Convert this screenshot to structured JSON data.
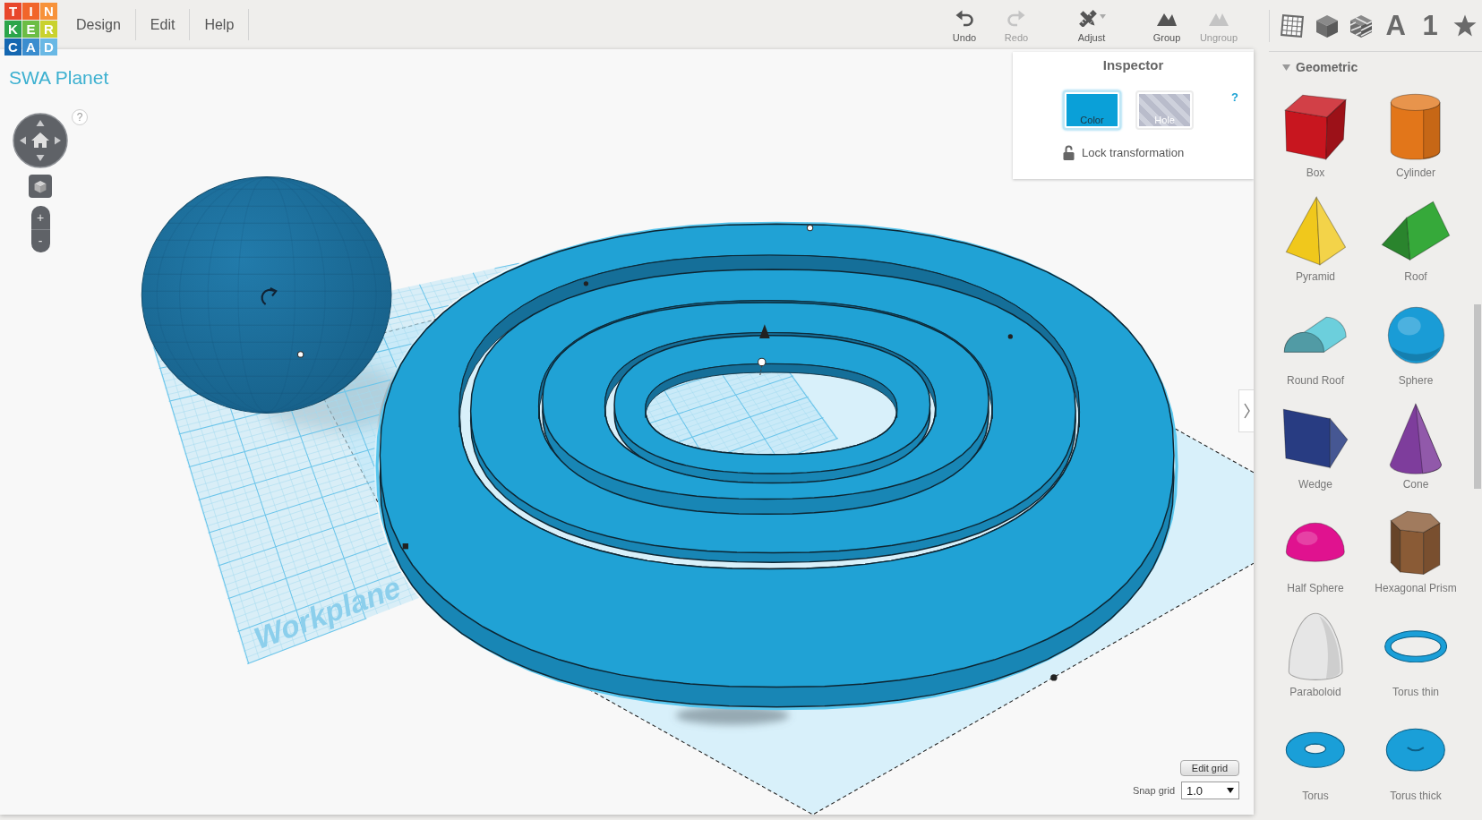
{
  "logo": [
    {
      "letter": "T",
      "color": "#e8472b"
    },
    {
      "letter": "I",
      "color": "#f1652a"
    },
    {
      "letter": "N",
      "color": "#f7923a"
    },
    {
      "letter": "K",
      "color": "#2ba54a"
    },
    {
      "letter": "E",
      "color": "#6cbd45"
    },
    {
      "letter": "R",
      "color": "#c9d22e"
    },
    {
      "letter": "C",
      "color": "#1467b1"
    },
    {
      "letter": "A",
      "color": "#3a8dcf"
    },
    {
      "letter": "D",
      "color": "#69b8e5"
    }
  ],
  "menu": [
    "Design",
    "Edit",
    "Help"
  ],
  "toolbar": [
    {
      "kind": "undo",
      "label": "Undo",
      "disabled": false
    },
    {
      "kind": "redo",
      "label": "Redo",
      "disabled": true
    },
    {
      "kind": "adjust",
      "label": "Adjust",
      "disabled": false
    },
    {
      "kind": "group",
      "label": "Group",
      "disabled": false
    },
    {
      "kind": "ungroup",
      "label": "Ungroup",
      "disabled": true
    }
  ],
  "view_tabs": [
    {
      "kind": "grid"
    },
    {
      "kind": "cube"
    },
    {
      "kind": "striped_cube"
    },
    {
      "kind": "letter",
      "label": "A"
    },
    {
      "kind": "number",
      "label": "1"
    },
    {
      "kind": "star"
    }
  ],
  "design_title": "SWA Planet",
  "view_controls": {
    "help": "?",
    "zoom_in": "+",
    "zoom_out": "-"
  },
  "inspector": {
    "title": "Inspector",
    "help": "?",
    "options": [
      {
        "kind": "color",
        "label": "Color",
        "selected": true,
        "color": "#0aa0d8"
      },
      {
        "kind": "hole",
        "label": "Hole",
        "selected": false
      }
    ],
    "lock": {
      "label": "Lock transformation",
      "locked": false
    }
  },
  "scene": {
    "workplane_label": "Workplane"
  },
  "grid_controls": {
    "edit_button": "Edit grid",
    "snap_label": "Snap grid",
    "snap_value": "1.0"
  },
  "library": {
    "section": "Geometric",
    "expanded": true,
    "shapes": [
      {
        "kind": "box",
        "label": "Box",
        "color": "#c8161f"
      },
      {
        "kind": "cylinder",
        "label": "Cylinder",
        "color": "#e2761a"
      },
      {
        "kind": "pyramid",
        "label": "Pyramid",
        "color": "#f0c81c"
      },
      {
        "kind": "roof",
        "label": "Roof",
        "color": "#36a93a"
      },
      {
        "kind": "round_roof",
        "label": "Round Roof",
        "color": "#6ccfdc"
      },
      {
        "kind": "sphere",
        "label": "Sphere",
        "color": "#1a9cd6"
      },
      {
        "kind": "wedge",
        "label": "Wedge",
        "color": "#283c82"
      },
      {
        "kind": "cone",
        "label": "Cone",
        "color": "#7e3d9c"
      },
      {
        "kind": "half_sphere",
        "label": "Half Sphere",
        "color": "#e0128f"
      },
      {
        "kind": "hexagonal_prism",
        "label": "Hexagonal Prism",
        "color": "#8a5b36"
      },
      {
        "kind": "paraboloid",
        "label": "Paraboloid",
        "color": "#e6e6e6"
      },
      {
        "kind": "torus_thin",
        "label": "Torus thin",
        "color": "#1a9fd8"
      },
      {
        "kind": "torus",
        "label": "Torus",
        "color": "#1a9fd8"
      },
      {
        "kind": "torus_thick",
        "label": "Torus thick",
        "color": "#1a9fd8"
      }
    ]
  }
}
